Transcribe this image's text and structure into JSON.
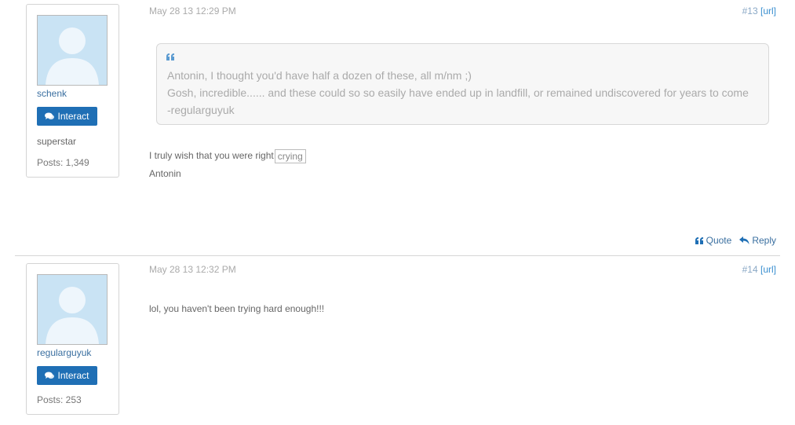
{
  "posts": [
    {
      "username": "schenk",
      "interact_label": "Interact",
      "rank": "superstar",
      "posts_count": "Posts: 1,349",
      "date": "May 28 13 12:29 PM",
      "post_number": "#13",
      "url_label": "[url]",
      "quote": {
        "lines": [
          "Antonin, I thought you'd have half a dozen of these, all m/nm ;)",
          "Gosh, incredible...... and these could so so easily have ended up in landfill, or remained undiscovered for years to come",
          "-regularguyuk"
        ]
      },
      "body": {
        "line1": "I truly wish that you were right",
        "image_alt": "crying",
        "line2": "Antonin"
      },
      "actions": {
        "quote_label": "Quote",
        "reply_label": "Reply"
      }
    },
    {
      "username": "regularguyuk",
      "interact_label": "Interact",
      "posts_count": "Posts: 253",
      "date": "May 28 13 12:32 PM",
      "post_number": "#14",
      "url_label": "[url]",
      "body": {
        "line1": "lol, you haven't been trying hard enough!!!"
      }
    }
  ],
  "icons": {
    "quote_mark": "quote-icon",
    "chat": "comments-icon",
    "reply": "reply-arrow-icon"
  },
  "colors": {
    "accent": "#1f6fb5",
    "link": "#3a6fa0",
    "avatar_bg": "#c3dff2"
  }
}
